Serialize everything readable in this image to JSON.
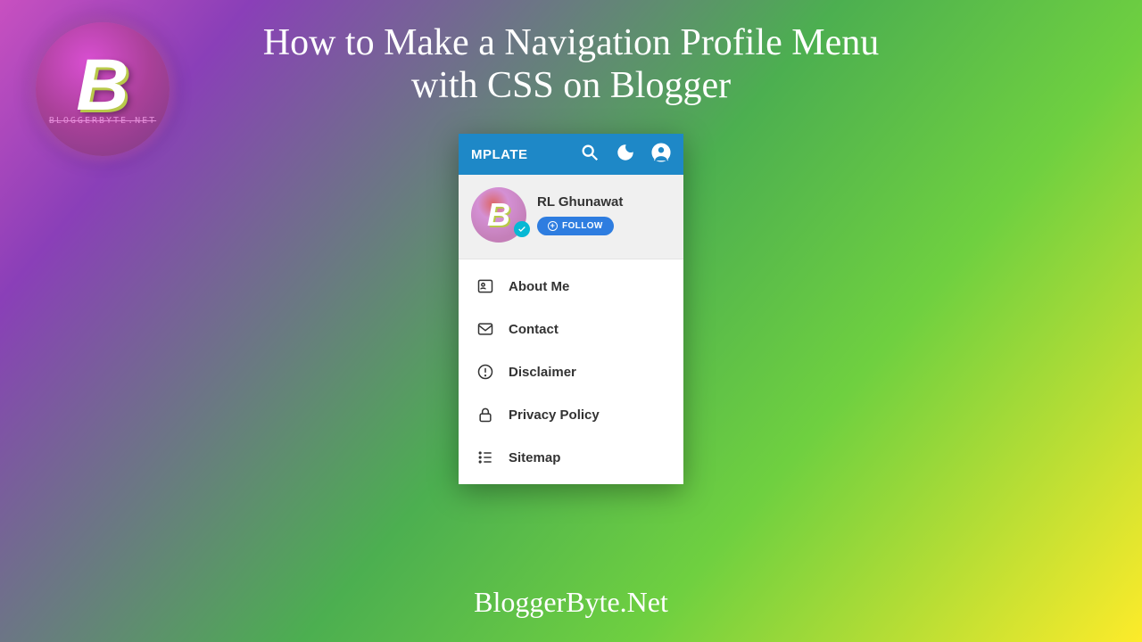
{
  "logo": {
    "letter": "B",
    "subtext": "BLOGGERBYTE.NET"
  },
  "headline_line1": "How to Make a Navigation Profile Menu",
  "headline_line2": "with CSS on Blogger",
  "card": {
    "brand": "MPLATE",
    "profile_name": "RL Ghunawat",
    "follow_label": "FOLLOW",
    "menu": [
      {
        "label": "About Me"
      },
      {
        "label": "Contact"
      },
      {
        "label": "Disclaimer"
      },
      {
        "label": "Privacy Policy"
      },
      {
        "label": "Sitemap"
      }
    ]
  },
  "footer": "BloggerByte.Net"
}
